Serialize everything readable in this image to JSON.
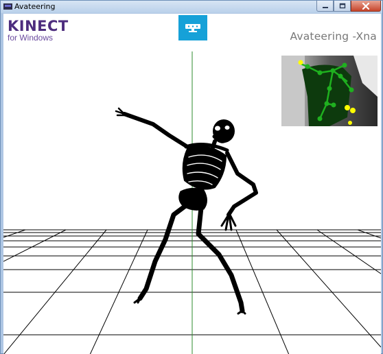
{
  "window": {
    "title": "Avateering"
  },
  "branding": {
    "logo_main": "KINECT",
    "logo_sub": "for Windows"
  },
  "app": {
    "title": "Avateering -Xna"
  },
  "colors": {
    "kinect_purple": "#4d2d7e",
    "sensor_tile": "#16a1d8",
    "center_line": "#2e8b2e",
    "joint_tracked": "#1fb01f",
    "joint_inferred": "#ffff00",
    "bone_color": "#000000",
    "floor_grid": "#000000"
  },
  "icons": {
    "app": "kinect-app-icon",
    "sensor": "kinect-sensor-icon",
    "minimize": "minimize-icon",
    "maximize": "maximize-icon",
    "close": "close-icon"
  }
}
